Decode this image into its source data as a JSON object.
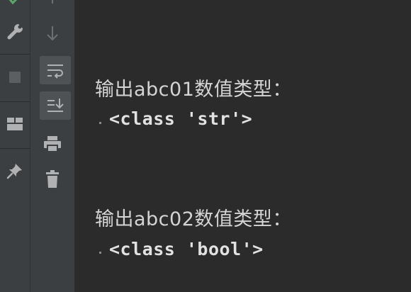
{
  "icons": {
    "left_strip": [
      "check-icon",
      "wrench-icon",
      "stop-icon",
      "layout-icon",
      "pin-icon"
    ],
    "console_toolbar": [
      "up-arrow-icon",
      "down-arrow-icon",
      "soft-wrap-icon",
      "scroll-to-end-icon",
      "print-icon",
      "trash-icon"
    ]
  },
  "colors": {
    "background": "#2b2b2b",
    "toolbar": "#3c3f41",
    "toggled": "#4e5254",
    "icon": "#afb1b3",
    "accent_check": "#59a869"
  },
  "console": {
    "lines": [
      "输出abc01数值类型：",
      "<class 'str'>",
      "输出abc02数值类型：",
      "<class 'bool'>"
    ]
  }
}
